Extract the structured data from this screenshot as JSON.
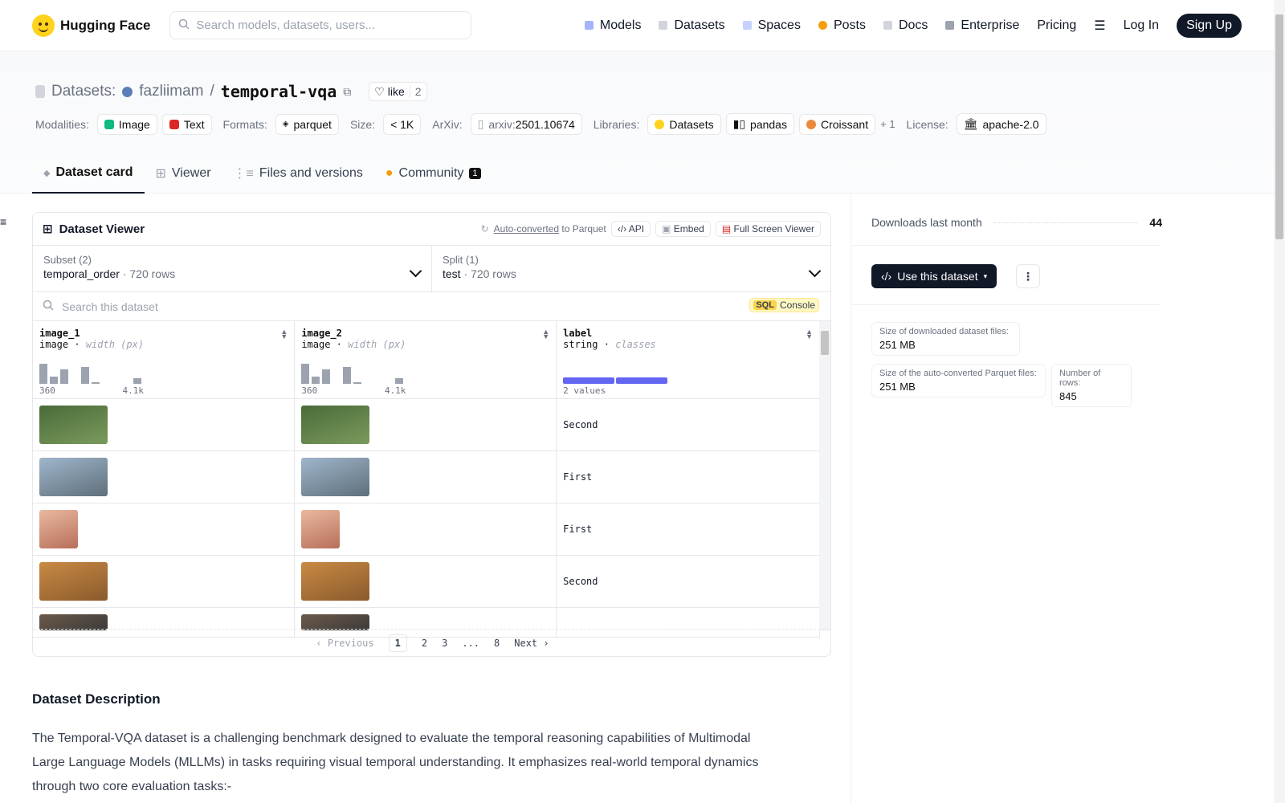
{
  "nav": {
    "brand": "Hugging Face",
    "search_placeholder": "Search models, datasets, users...",
    "links": [
      "Models",
      "Datasets",
      "Spaces",
      "Posts",
      "Docs",
      "Enterprise",
      "Pricing"
    ],
    "login": "Log In",
    "signup": "Sign Up"
  },
  "header": {
    "section": "Datasets:",
    "owner": "fazliimam",
    "separator": "/",
    "name": "temporal-vqa",
    "like_label": "like",
    "like_count": "2",
    "modalities_label": "Modalities:",
    "modalities": [
      "Image",
      "Text"
    ],
    "formats_label": "Formats:",
    "format": "parquet",
    "size_label": "Size:",
    "size": "< 1K",
    "arxiv_label": "ArXiv:",
    "arxiv_prefix": "arxiv:",
    "arxiv": "2501.10674",
    "libraries_label": "Libraries:",
    "libraries": [
      "Datasets",
      "pandas",
      "Croissant"
    ],
    "libraries_more": "+ 1",
    "license_label": "License:",
    "license": "apache-2.0"
  },
  "tabs": [
    "Dataset card",
    "Viewer",
    "Files and versions",
    "Community"
  ],
  "community_count": "1",
  "viewer": {
    "title": "Dataset Viewer",
    "auto_converted": "Auto-converted",
    "to_parquet": "to Parquet",
    "api": "API",
    "embed": "Embed",
    "fullscreen": "Full Screen Viewer",
    "subset_caption": "Subset (2)",
    "subset_value": "temporal_order",
    "subset_rows": "720 rows",
    "split_caption": "Split (1)",
    "split_value": "test",
    "split_rows": "720 rows",
    "search_placeholder": "Search this dataset",
    "sql": "SQL",
    "console": "Console",
    "columns": [
      {
        "name": "image_1",
        "type": "image",
        "subtype": "width (px)",
        "min": "360",
        "max": "4.1k"
      },
      {
        "name": "image_2",
        "type": "image",
        "subtype": "width (px)",
        "min": "360",
        "max": "4.1k"
      },
      {
        "name": "label",
        "type": "string",
        "subtype": "classes",
        "summary": "2 values"
      }
    ],
    "histogram": [
      0.85,
      0.3,
      0.6,
      0,
      0.7,
      0.08,
      0,
      0,
      0,
      0.25
    ],
    "rows": [
      {
        "label": "Second",
        "colors": [
          "#4a6b3a",
          "#7a9a5c"
        ]
      },
      {
        "label": "First",
        "colors": [
          "#9fb6cc",
          "#5f6f7a"
        ]
      },
      {
        "label": "First",
        "colors": [
          "#e9b8a0",
          "#b86f5a"
        ]
      },
      {
        "label": "Second",
        "colors": [
          "#c98a44",
          "#8a5a2c"
        ]
      },
      {
        "label": "",
        "colors": [
          "#6b5a4a",
          "#3b3a3a"
        ]
      }
    ],
    "pager": {
      "prev": "Previous",
      "pages": [
        "1",
        "2",
        "3",
        "...",
        "8"
      ],
      "next": "Next"
    }
  },
  "description": {
    "title": "Dataset Description",
    "text": "The Temporal-VQA dataset is a challenging benchmark designed to evaluate the temporal reasoning capabilities of Multimodal Large Language Models (MLLMs) in tasks requiring visual temporal understanding. It emphasizes real-world temporal dynamics through two core evaluation tasks:-"
  },
  "sidebar": {
    "downloads_label": "Downloads last month",
    "downloads": "44",
    "use_button": "Use this dataset",
    "stats": [
      {
        "label": "Size of downloaded dataset files:",
        "value": "251 MB"
      },
      {
        "label": "Size of the auto-converted Parquet files:",
        "value": "251 MB"
      },
      {
        "label": "Number of rows:",
        "value": "845"
      }
    ]
  }
}
